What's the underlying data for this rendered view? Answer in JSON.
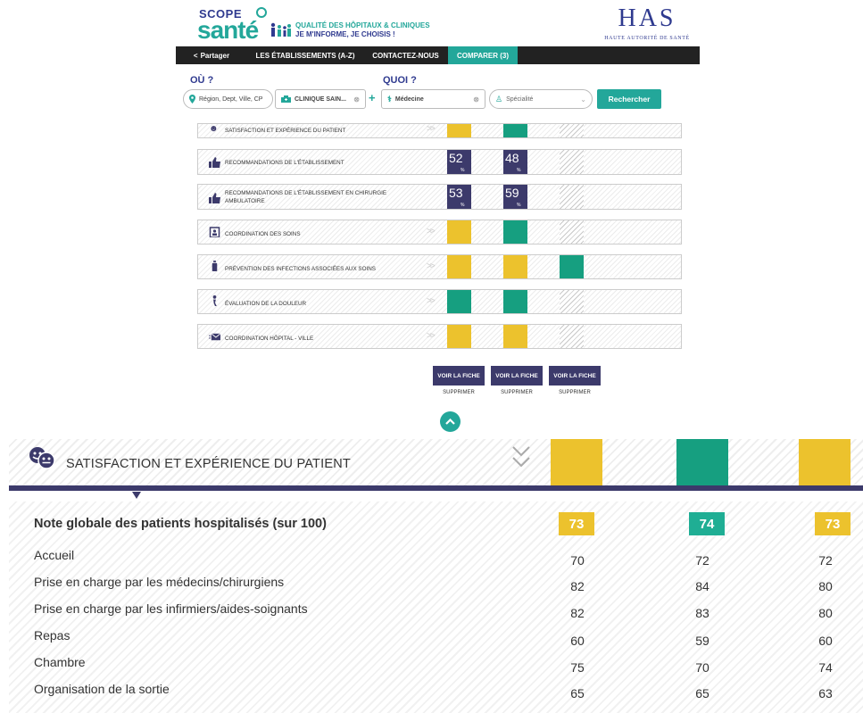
{
  "header": {
    "logo_scope": "SCOPE",
    "logo_sante": "santé",
    "tagline_line1": "QUALITÉ DES HÔPITAUX & CLINIQUES",
    "tagline_line2": "JE M'INFORME, JE CHOISIS !",
    "has_logo": "HAS",
    "has_subtitle": "HAUTE AUTORITÉ DE SANTÉ"
  },
  "nav": {
    "share": "Partager",
    "establishments": "LES ÉTABLISSEMENTS (A-Z)",
    "contact": "CONTACTEZ-NOUS",
    "compare": "COMPARER (3)"
  },
  "search": {
    "where_label": "OÙ ?",
    "what_label": "QUOI ?",
    "region_placeholder": "Région, Dept, Ville, CP",
    "clinic_value": "CLINIQUE SAIN...",
    "medecine_value": "Médecine",
    "specialty_placeholder": "Spécialité",
    "search_button": "Rechercher"
  },
  "comparison_rows": [
    {
      "label": "SATISFACTION ET EXPÉRIENCE DU PATIENT",
      "icon": "smiley-faces-icon",
      "cells": [
        {
          "kind": "yellow"
        },
        {
          "kind": "green"
        },
        {
          "kind": "na"
        }
      ]
    },
    {
      "label": "RECOMMANDATIONS DE L'ÉTABLISSEMENT",
      "icon": "thumbs-up-icon",
      "cells": [
        {
          "kind": "value",
          "value": "52",
          "unit": "%"
        },
        {
          "kind": "value",
          "value": "48",
          "unit": "%"
        },
        {
          "kind": "na"
        }
      ]
    },
    {
      "label": "RECOMMANDATIONS DE L'ÉTABLISSEMENT EN CHIRURGIE AMBULATOIRE",
      "icon": "thumbs-up-icon",
      "cells": [
        {
          "kind": "value",
          "value": "53",
          "unit": "%"
        },
        {
          "kind": "value",
          "value": "59",
          "unit": "%"
        },
        {
          "kind": "na"
        }
      ]
    },
    {
      "label": "COORDINATION DES SOINS",
      "icon": "clipboard-icon",
      "cells": [
        {
          "kind": "yellow"
        },
        {
          "kind": "green"
        },
        {
          "kind": "na"
        }
      ]
    },
    {
      "label": "PRÉVENTION DES INFECTIONS ASSOCIÉES AUX SOINS",
      "icon": "sanitizer-icon",
      "cells": [
        {
          "kind": "yellow"
        },
        {
          "kind": "yellow"
        },
        {
          "kind": "green"
        }
      ]
    },
    {
      "label": "ÉVALUATION DE LA DOULEUR",
      "icon": "pain-icon",
      "cells": [
        {
          "kind": "green"
        },
        {
          "kind": "green"
        },
        {
          "kind": "na"
        }
      ]
    },
    {
      "label": "COORDINATION HÔPITAL - VILLE",
      "icon": "letter-icon",
      "cells": [
        {
          "kind": "yellow"
        },
        {
          "kind": "yellow"
        },
        {
          "kind": "na"
        }
      ]
    }
  ],
  "actions": {
    "view_sheet": "VOIR LA FICHE",
    "remove": "SUPPRIMER"
  },
  "detail": {
    "title": "SATISFACTION ET EXPÉRIENCE DU PATIENT",
    "global": {
      "label": "Note globale des patients hospitalisés (sur 100)",
      "values": [
        "73",
        "74",
        "73"
      ]
    },
    "rows": [
      {
        "label": "Accueil",
        "values": [
          "70",
          "72",
          "72"
        ]
      },
      {
        "label": "Prise en charge par les médecins/chirurgiens",
        "values": [
          "82",
          "84",
          "80"
        ]
      },
      {
        "label": "Prise en charge par les infirmiers/aides-soignants",
        "values": [
          "82",
          "83",
          "80"
        ]
      },
      {
        "label": "Repas",
        "values": [
          "60",
          "59",
          "60"
        ]
      },
      {
        "label": "Chambre",
        "values": [
          "75",
          "70",
          "74"
        ]
      },
      {
        "label": "Organisation de la sortie",
        "values": [
          "65",
          "65",
          "63"
        ]
      }
    ]
  },
  "colors": {
    "brand_teal": "#23a79a",
    "brand_navy": "#2f3a8f",
    "score_yellow": "#ecc22d",
    "score_green": "#169f80",
    "value_navy": "#3c3a6b"
  }
}
